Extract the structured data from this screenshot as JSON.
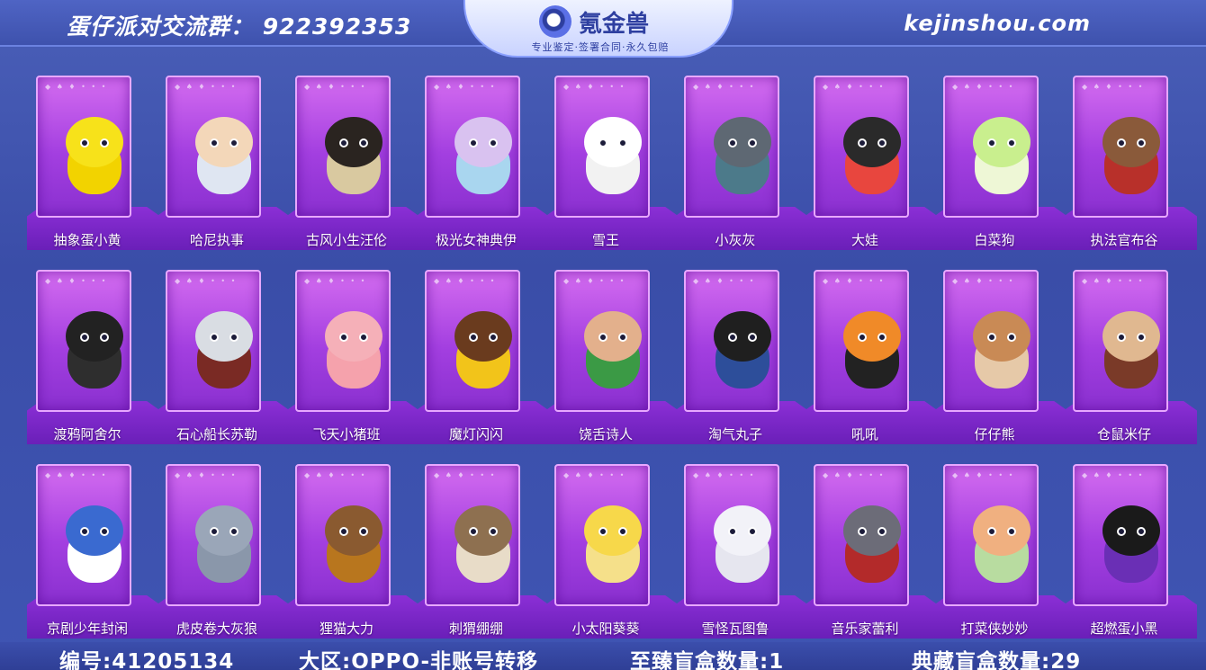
{
  "header": {
    "left_text": "蛋仔派对交流群：  922392353",
    "logo_name": "氪金兽",
    "logo_tagline": "专业鉴定·签署合同·永久包赔",
    "site_url": "kejinshou.com",
    "logo_icon": "monster-eye-logo-icon"
  },
  "items": [
    {
      "name": "抽象蛋小黄",
      "head": "#f7e21a",
      "body": "#f2d300"
    },
    {
      "name": "哈尼执事",
      "head": "#f3d7b9",
      "body": "#dfe6f2"
    },
    {
      "name": "古风小生汪伦",
      "head": "#2a2420",
      "body": "#d9c9a0"
    },
    {
      "name": "极光女神典伊",
      "head": "#d9c2f0",
      "body": "#a9d6ef"
    },
    {
      "name": "雪王",
      "head": "#ffffff",
      "body": "#f2f2f2"
    },
    {
      "name": "小灰灰",
      "head": "#5e6873",
      "body": "#4c7a8a"
    },
    {
      "name": "大娃",
      "head": "#2a2a2a",
      "body": "#e8463e"
    },
    {
      "name": "白菜狗",
      "head": "#c9ef8e",
      "body": "#eef7d6"
    },
    {
      "name": "执法官布谷",
      "head": "#8a5a3a",
      "body": "#b8302a"
    },
    {
      "name": "渡鸦阿舍尔",
      "head": "#222222",
      "body": "#2e2e2e"
    },
    {
      "name": "石心船长苏勒",
      "head": "#d9dde3",
      "body": "#7a2a24"
    },
    {
      "name": "飞天小猪班",
      "head": "#f5b0b8",
      "body": "#f5a2ac"
    },
    {
      "name": "魔灯闪闪",
      "head": "#6a3b1e",
      "body": "#f2c41a"
    },
    {
      "name": "饶舌诗人",
      "head": "#e3b08c",
      "body": "#3b9a45"
    },
    {
      "name": "淘气丸子",
      "head": "#1f1f1f",
      "body": "#2d4e9a"
    },
    {
      "name": "吼吼",
      "head": "#f08a28",
      "body": "#222222"
    },
    {
      "name": "仔仔熊",
      "head": "#c98a55",
      "body": "#e6c9a8"
    },
    {
      "name": "仓鼠米仔",
      "head": "#e0b890",
      "body": "#7a3a28"
    },
    {
      "name": "京剧少年封闲",
      "head": "#3a6ad0",
      "body": "#ffffff"
    },
    {
      "name": "虎皮卷大灰狼",
      "head": "#9aa6b8",
      "body": "#8a97aa"
    },
    {
      "name": "狸猫大力",
      "head": "#8a5a30",
      "body": "#b8761e"
    },
    {
      "name": "刺猬绷绷",
      "head": "#8e7050",
      "body": "#e8dcc8"
    },
    {
      "name": "小太阳葵葵",
      "head": "#f7d84a",
      "body": "#f5e08a"
    },
    {
      "name": "雪怪瓦图鲁",
      "head": "#f2f2f8",
      "body": "#e6e6ef"
    },
    {
      "name": "音乐家蕾利",
      "head": "#6c6c78",
      "body": "#b32a2a"
    },
    {
      "name": "打菜侠妙妙",
      "head": "#f0b080",
      "body": "#b8dca0"
    },
    {
      "name": "超燃蛋小黑",
      "head": "#1a1a1a",
      "body": "#6a2fb5"
    }
  ],
  "footer": {
    "id_text": "编号:41205134",
    "server_text": "大区:OPPO-非账号转移",
    "premium_text": "至臻盲盒数量:1",
    "collection_text": "典藏盲盒数量:29"
  }
}
